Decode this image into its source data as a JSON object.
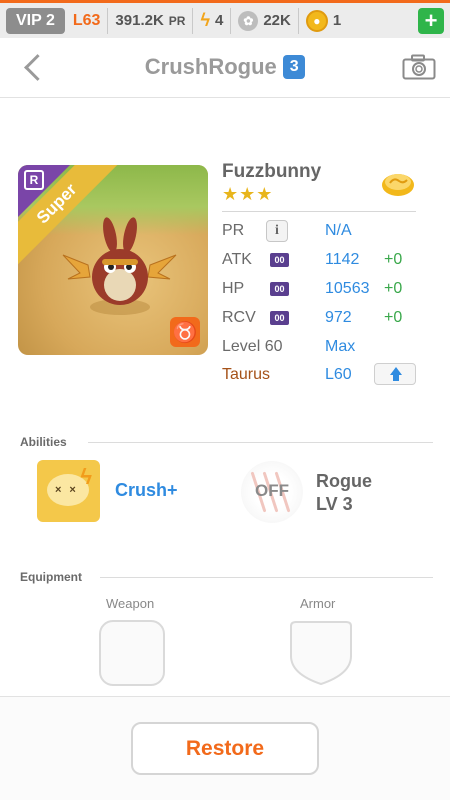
{
  "status_bar": {
    "vip": "VIP 2",
    "level": "L63",
    "pr_value": "391.2K",
    "pr_unit": "PR",
    "energy": "4",
    "pets": "22K",
    "coins": "1"
  },
  "header": {
    "title": "CrushRogue",
    "badge": "3"
  },
  "pet": {
    "rarity_tag": "R",
    "ribbon": "Super",
    "name": "Fuzzbunny",
    "stars": "★★★",
    "stats": {
      "pr": {
        "label": "PR",
        "value": "N/A"
      },
      "atk": {
        "label": "ATK",
        "chip": "00",
        "value": "1142",
        "bonus": "+0"
      },
      "hp": {
        "label": "HP",
        "chip": "00",
        "value": "10563",
        "bonus": "+0"
      },
      "rcv": {
        "label": "RCV",
        "chip": "00",
        "value": "972",
        "bonus": "+0"
      },
      "level": {
        "label": "Level 60",
        "value": "Max"
      },
      "zodiac": {
        "label": "Taurus",
        "value": "L60"
      }
    }
  },
  "abilities": {
    "section_label": "Abilities",
    "ability1_label": "Crush+",
    "ability2_state": "OFF",
    "ability2_name": "Rogue",
    "ability2_level": "LV 3"
  },
  "equipment": {
    "section_label": "Equipment",
    "weapon_label": "Weapon",
    "armor_label": "Armor"
  },
  "footer": {
    "restore_label": "Restore"
  },
  "colors": {
    "accent_orange": "#f26a1b",
    "link_blue": "#2f8be0",
    "bonus_green": "#3aa84b",
    "star_gold": "#e8b51c"
  }
}
